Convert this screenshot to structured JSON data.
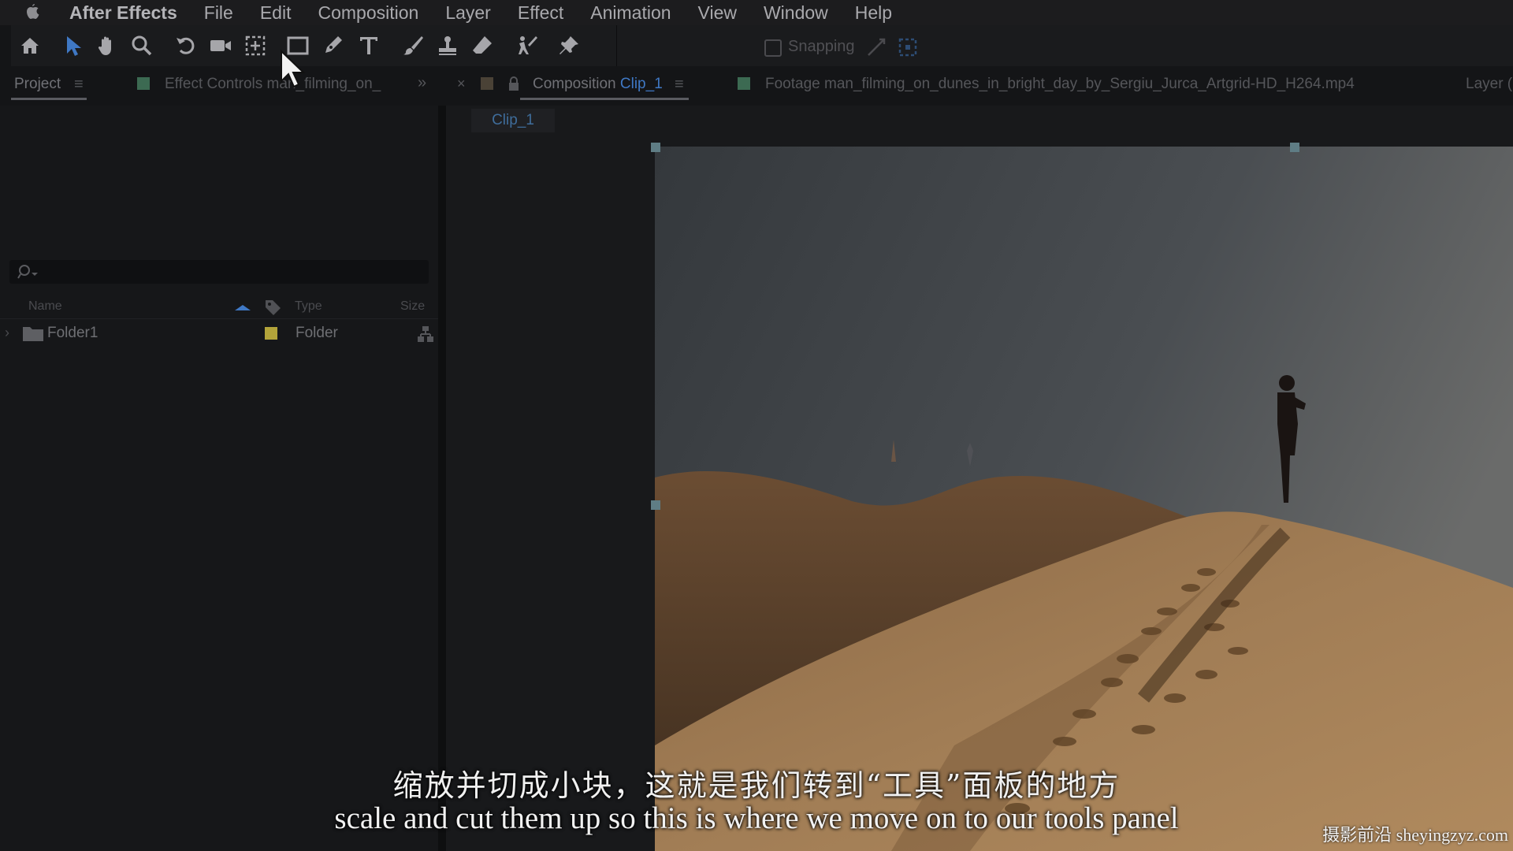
{
  "menubar": {
    "app_name": "After Effects",
    "items": [
      "File",
      "Edit",
      "Composition",
      "Layer",
      "Effect",
      "Animation",
      "View",
      "Window",
      "Help"
    ]
  },
  "toolbar": {
    "tools": [
      "home-icon",
      "selection-tool-icon",
      "hand-tool-icon",
      "zoom-tool-icon",
      "rotation-tool-icon",
      "camera-tool-icon",
      "pan-behind-tool-icon",
      "rectangle-tool-icon",
      "pen-tool-icon",
      "type-tool-icon",
      "brush-tool-icon",
      "clone-stamp-tool-icon",
      "eraser-tool-icon",
      "roto-brush-tool-icon",
      "puppet-pin-tool-icon"
    ],
    "snapping_label": "Snapping",
    "snapping_checked": false
  },
  "panels": {
    "project_tab": "Project",
    "effect_controls_tab": "Effect Controls man_filming_on_",
    "overflow": "»",
    "comp_close": "×",
    "comp_tab_prefix": "Composition",
    "comp_tab_name": "Clip_1",
    "footage_tab": "Footage man_filming_on_dunes_in_bright_day_by_Sergiu_Jurca_Artgrid-HD_H264.mp4",
    "layer_tab": "Layer (",
    "comp_subtab": "Clip_1"
  },
  "project": {
    "search_placeholder": "",
    "columns": {
      "name": "Name",
      "type": "Type",
      "size": "Size"
    },
    "items": [
      {
        "name": "Folder1",
        "type": "Folder",
        "label_color": "#b3a43a"
      }
    ]
  },
  "subtitles": {
    "chinese": "缩放并切成小块，这就是我们转到“工具”面板的地方",
    "english": "scale and cut them up so this is where we move on to our tools panel"
  },
  "watermark": "摄影前沿 sheyingzyz.com",
  "colors": {
    "accent_blue": "#3f78c4",
    "panel_bg": "#161719",
    "label_green": "#3c6a52"
  }
}
